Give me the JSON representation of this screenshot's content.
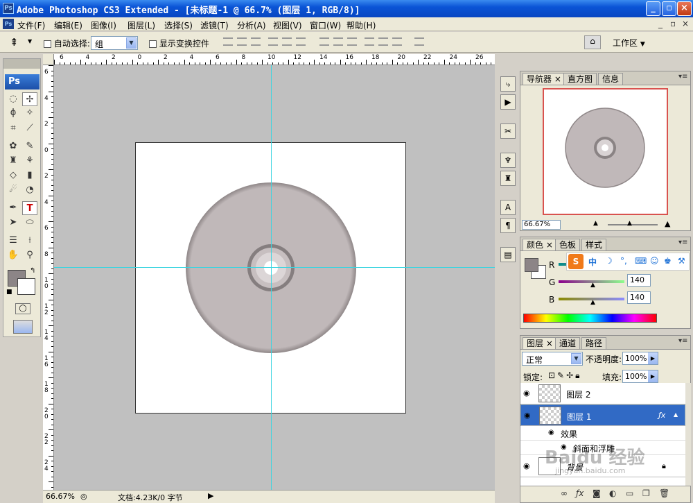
{
  "titlebar": {
    "title": "Adobe Photoshop CS3 Extended - [未标题-1 @ 66.7% (图层 1, RGB/8)]"
  },
  "menubar": {
    "items": [
      "文件(F)",
      "编辑(E)",
      "图像(I)",
      "图层(L)",
      "选择(S)",
      "滤镜(T)",
      "分析(A)",
      "视图(V)",
      "窗口(W)",
      "帮助(H)"
    ]
  },
  "options": {
    "auto_select_label": "自动选择:",
    "auto_select_value": "组",
    "transform_label": "显示变换控件",
    "workspace_label": "工作区"
  },
  "toolbox": {
    "logo": "Ps"
  },
  "rulers": {
    "top": [
      "6",
      "4",
      "2",
      "0",
      "2",
      "4",
      "6",
      "8",
      "10",
      "12",
      "14",
      "16",
      "18",
      "20",
      "22",
      "24",
      "26"
    ],
    "left": [
      "6",
      "4",
      "2",
      "0",
      "2",
      "4",
      "6",
      "8",
      "10",
      "12",
      "14",
      "16",
      "18",
      "20",
      "22",
      "24"
    ]
  },
  "status": {
    "zoom": "66.67%",
    "doc_info": "文档:4.23K/0 字节"
  },
  "navigator": {
    "tabs": [
      "导航器",
      "直方图",
      "信息"
    ],
    "zoom": "66.67%"
  },
  "color_panel": {
    "tabs": [
      "颜色",
      "色板",
      "样式"
    ],
    "r_label": "R",
    "g_label": "G",
    "b_label": "B",
    "g_value": "140",
    "b_value": "140",
    "fg_color": "#8c8c8c",
    "ime_label": "中"
  },
  "layers_panel": {
    "tabs": [
      "图层",
      "通道",
      "路径"
    ],
    "blend_mode": "正常",
    "opacity_label": "不透明度:",
    "opacity": "100%",
    "lock_label": "锁定:",
    "fill_label": "填充:",
    "fill": "100%",
    "layers": [
      {
        "name": "图层 2"
      },
      {
        "name": "图层 1"
      },
      {
        "name": "效果"
      },
      {
        "name": "斜面和浮雕"
      },
      {
        "name": "背景"
      }
    ]
  },
  "watermark": {
    "text": "Baidu 经验",
    "url": "jingyan.baidu.com"
  },
  "colors": {
    "disc": "#c0b8b9",
    "accent": "#316ac5",
    "guide": "#3ad4e0"
  }
}
